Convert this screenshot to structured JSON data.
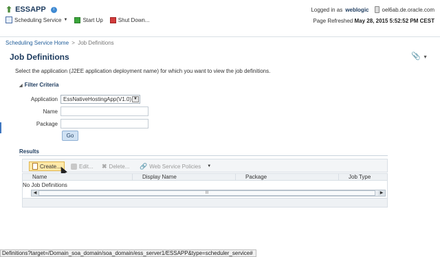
{
  "app": {
    "name": "ESSAPP"
  },
  "login": {
    "prefix": "Logged in as",
    "user": "weblogic",
    "host": "oel6ab.de.oracle.com"
  },
  "toolbar": {
    "scheduling_service": "Scheduling Service",
    "start_up": "Start Up",
    "shut_down": "Shut Down..."
  },
  "refresh": {
    "label": "Page Refreshed",
    "timestamp": "May 28, 2015 5:52:52 PM CEST"
  },
  "breadcrumb": {
    "home": "Scheduling Service Home",
    "separator": ">",
    "current": "Job Definitions"
  },
  "page": {
    "title": "Job Definitions",
    "description": "Select the application (J2EE application deployment name) for which you want to view the job definitions."
  },
  "filter": {
    "title": "Filter Criteria",
    "application_label": "Application",
    "application_value": "EssNativeHostingApp(V1.0)",
    "name_label": "Name",
    "package_label": "Package",
    "go_label": "Go"
  },
  "results": {
    "title": "Results",
    "actions": {
      "create": "Create...",
      "edit": "Edit...",
      "delete": "Delete...",
      "web_service_policies": "Web Service Policies"
    },
    "columns": [
      "Name",
      "Display Name",
      "Package",
      "Job Type"
    ],
    "empty_text": "No Job Definitions",
    "scroll_grip": "III"
  },
  "statusbar": {
    "url": "Definitions?target=/Domain_soa_domain/soa_domain/ess_server1/ESSAPP&type=scheduler_service#"
  }
}
